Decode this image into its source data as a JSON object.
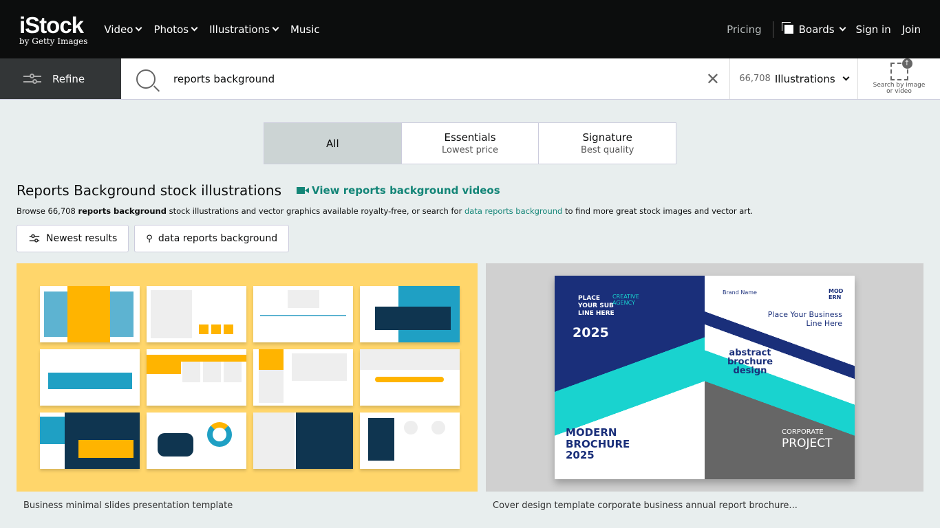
{
  "header": {
    "logo": "iStock",
    "logo_sub": "by Getty Images",
    "nav": [
      "Video",
      "Photos",
      "Illustrations",
      "Music"
    ],
    "pricing": "Pricing",
    "boards": "Boards",
    "sign_in": "Sign in",
    "join": "Join"
  },
  "search": {
    "refine": "Refine",
    "query": "reports background",
    "count": "66,708",
    "type": "Illustrations",
    "search_by_image": "Search by image",
    "search_by_image2": "or video"
  },
  "tabs": [
    {
      "label": "All"
    },
    {
      "label": "Essentials",
      "sub": "Lowest price"
    },
    {
      "label": "Signature",
      "sub": "Best quality"
    }
  ],
  "page": {
    "title": "Reports Background stock illustrations",
    "video_link": "View reports background videos",
    "desc_pre": "Browse 66,708 ",
    "desc_bold": "reports background",
    "desc_mid": " stock illustrations and vector graphics available royalty-free, or search for ",
    "desc_link": "data reports background",
    "desc_post": " to find more great stock images and vector art."
  },
  "chips": [
    "Newest results",
    "data reports background"
  ],
  "results": [
    {
      "caption": "Business minimal slides presentation template"
    },
    {
      "caption": "Cover design template corporate business annual report brochure..."
    }
  ],
  "brochure": {
    "l1": "PLACE YOUR SUB LINE HERE",
    "year": "2025",
    "creative": "CREATIVE AGENCY",
    "modern": "MODERN BROCHURE 2025",
    "brand": "Brand Name",
    "mod": "MOD ERN",
    "place": "Place Your Business Line Here",
    "abs": "abstract brochure design",
    "corp": "CORPORATE",
    "proj": "PROJECT"
  },
  "colors": {
    "accent": "#138577",
    "header_bg": "#0c0d0d"
  }
}
